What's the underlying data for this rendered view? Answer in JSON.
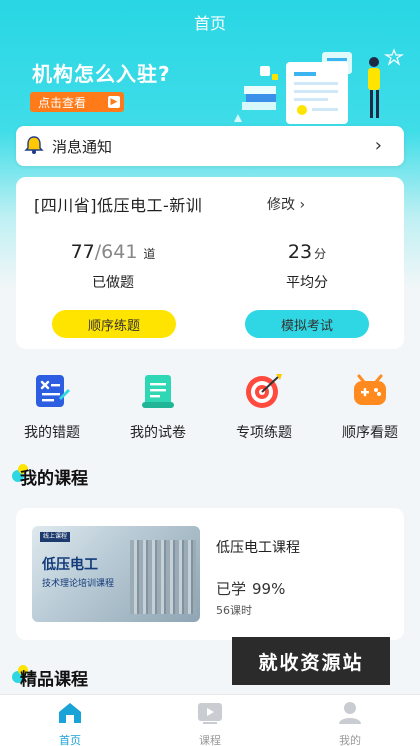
{
  "header": {
    "title": "首页"
  },
  "banner": {
    "title": "机构怎么入驻?",
    "button_label": "点击查看"
  },
  "notice": {
    "label": "消息通知"
  },
  "stats": {
    "course_name": "[四川省]低压电工-新训",
    "edit_label": "修改",
    "done_count": "77",
    "total_count": "641",
    "count_unit": "道",
    "done_label": "已做题",
    "avg_score": "23",
    "score_unit": "分",
    "avg_label": "平均分",
    "btn_sequence": "顺序练题",
    "btn_mock": "模拟考试"
  },
  "quick_actions": [
    {
      "label": "我的错题",
      "icon": "wrong-questions-icon"
    },
    {
      "label": "我的试卷",
      "icon": "papers-icon"
    },
    {
      "label": "专项练题",
      "icon": "target-icon"
    },
    {
      "label": "顺序看题",
      "icon": "game-icon"
    }
  ],
  "my_courses": {
    "heading": "我的课程",
    "course": {
      "thumb_tag": "线上课程",
      "thumb_title": "低压电工",
      "thumb_subtitle": "技术理论培训课程",
      "title": "低压电工课程",
      "progress_label": "已学",
      "progress_pct": "99%",
      "hours": "56课时"
    }
  },
  "featured": {
    "heading": "精品课程"
  },
  "watermark": "就收资源站",
  "tabs": [
    {
      "label": "首页",
      "active": true
    },
    {
      "label": "课程",
      "active": false
    },
    {
      "label": "我的",
      "active": false
    }
  ],
  "colors": {
    "primary": "#2fd7e4",
    "yellow": "#ffe400",
    "orange": "#ff7a18",
    "tab_active": "#1aa3d6"
  }
}
